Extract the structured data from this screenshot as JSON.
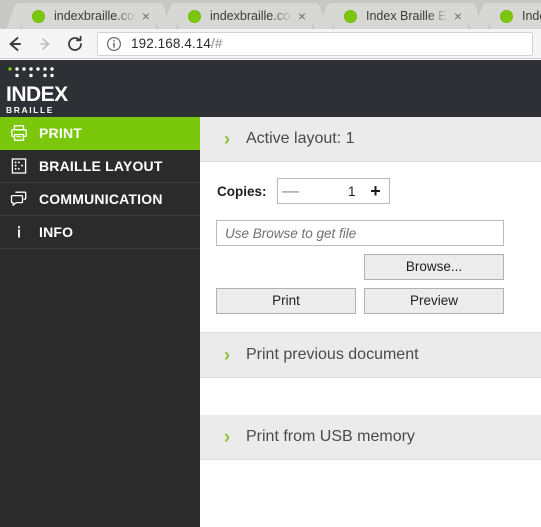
{
  "browser": {
    "tabs": [
      {
        "title": "indexbraille.com",
        "favicon": "green-dot-icon",
        "close": "×"
      },
      {
        "title": "indexbraille.com",
        "favicon": "green-dot-icon",
        "close": "×"
      },
      {
        "title": "Index Braille Emb",
        "favicon": "green-dot-icon",
        "close": "×"
      },
      {
        "title": "Index Br",
        "favicon": "green-dot-icon",
        "close": "×"
      }
    ],
    "nav": {
      "back": "back-arrow-icon",
      "forward": "forward-arrow-icon",
      "reload": "reload-icon"
    },
    "url": {
      "security_icon": "info-circle-icon",
      "host": "192.168.4.14",
      "path": "/#"
    }
  },
  "brand": {
    "name": "INDEX",
    "subtitle": "BRAILLE"
  },
  "sidebar": {
    "items": [
      {
        "label": "PRINT",
        "icon": "printer-icon",
        "active": true
      },
      {
        "label": "BRAILLE LAYOUT",
        "icon": "document-icon",
        "active": false
      },
      {
        "label": "COMMUNICATION",
        "icon": "chat-icon",
        "active": false
      },
      {
        "label": "INFO",
        "icon": "info-icon",
        "active": false
      }
    ]
  },
  "content": {
    "sections": [
      {
        "title": "Active layout: 1",
        "chevron": "›"
      },
      {
        "title": "Print previous document",
        "chevron": "›"
      },
      {
        "title": "Print from USB memory",
        "chevron": "›"
      }
    ],
    "copies": {
      "label": "Copies:",
      "minus": "—",
      "value": "1",
      "plus": "+"
    },
    "file": {
      "placeholder": "Use Browse to get file",
      "value": ""
    },
    "buttons": {
      "browse": "Browse...",
      "print": "Print",
      "preview": "Preview"
    }
  },
  "colors": {
    "accent_green": "#7ac70c",
    "chevron_green": "#8dc63f",
    "sidebar_dark": "#2b2b2b",
    "topbar_dark": "#2d3034",
    "section_header_bg": "#ebebeb"
  }
}
